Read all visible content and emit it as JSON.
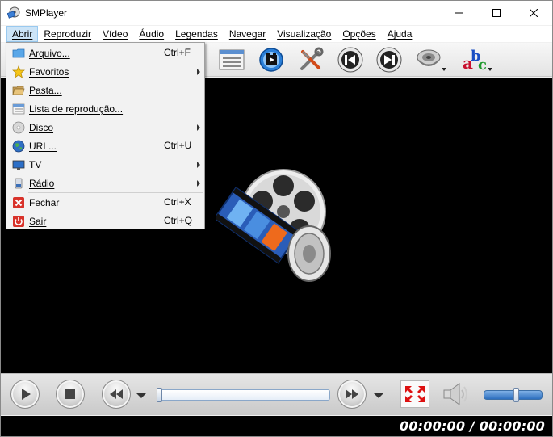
{
  "window": {
    "title": "SMPlayer"
  },
  "menubar": {
    "items": [
      {
        "label": "Abrir",
        "active": true
      },
      {
        "label": "Reproduzir"
      },
      {
        "label": "Vídeo"
      },
      {
        "label": "Áudio"
      },
      {
        "label": "Legendas"
      },
      {
        "label": "Navegar"
      },
      {
        "label": "Visualização"
      },
      {
        "label": "Opções"
      },
      {
        "label": "Ajuda"
      }
    ]
  },
  "open_menu": {
    "items": [
      {
        "label": "Arquivo...",
        "shortcut": "Ctrl+F",
        "icon": "folder-icon"
      },
      {
        "label": "Favoritos",
        "submenu": true,
        "icon": "star-icon"
      },
      {
        "label": "Pasta...",
        "icon": "folder-open-icon"
      },
      {
        "label": "Lista de reprodução...",
        "icon": "playlist-icon"
      },
      {
        "label": "Disco",
        "submenu": true,
        "icon": "disc-icon"
      },
      {
        "label": "URL...",
        "shortcut": "Ctrl+U",
        "icon": "globe-icon"
      },
      {
        "label": "TV",
        "submenu": true,
        "icon": "tv-icon"
      },
      {
        "label": "Rádio",
        "submenu": true,
        "icon": "radio-icon"
      },
      {
        "label": "Fechar",
        "shortcut": "Ctrl+X",
        "icon": "close-icon"
      },
      {
        "label": "Sair",
        "shortcut": "Ctrl+Q",
        "icon": "power-icon"
      }
    ]
  },
  "toolbar": {
    "icons": [
      "playlist-icon",
      "screenshot-icon",
      "preferences-icon",
      "previous-icon",
      "next-icon",
      "audio-track-icon",
      "subtitle-track-icon"
    ]
  },
  "controls": {
    "seek_position": 0,
    "volume_level": 0.5
  },
  "timebar": {
    "time": "00:00:00 / 00:00:00"
  },
  "colors": {
    "menu_highlight": "#cce4f7",
    "video_background": "#000000",
    "accent_blue": "#2d6fbf"
  }
}
